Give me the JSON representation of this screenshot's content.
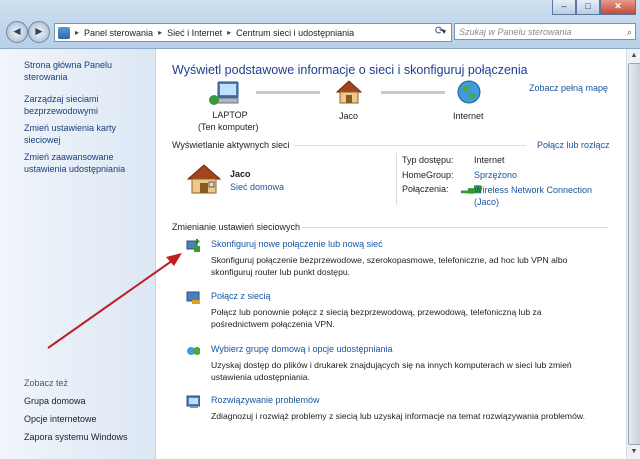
{
  "window": {
    "minimize": "–",
    "maximize": "□",
    "close": "✕"
  },
  "nav": {
    "back": "◄",
    "forward": "►",
    "breadcrumbs": [
      "Panel sterowania",
      "Sieć i Internet",
      "Centrum sieci i udostępniania"
    ],
    "search_placeholder": "Szukaj w Panelu sterowania",
    "search_icon": "magnifier-icon",
    "refresh_icon": "refresh-icon"
  },
  "sidebar": {
    "links": [
      {
        "line1": "Strona główna Panelu",
        "line2": "sterowania"
      },
      {
        "line1": "Zarządzaj sieciami",
        "line2": "bezprzewodowymi"
      },
      {
        "line1": "Zmień ustawienia karty",
        "line2": "sieciowej"
      },
      {
        "line1": "Zmień zaawansowane",
        "line2": "ustawienia udostępniania"
      }
    ],
    "see_also_heading": "Zobacz też",
    "see_also": [
      "Grupa domowa",
      "Opcje internetowe",
      "Zapora systemu Windows"
    ]
  },
  "main": {
    "title": "Wyświetl podstawowe informacje o sieci i skonfiguruj połączenia",
    "full_map_link": "Zobacz pełną mapę",
    "map": {
      "computer_name": "LAPTOP",
      "computer_sub": "(Ten komputer)",
      "network_name": "Jaco",
      "internet_label": "Internet"
    },
    "active_networks_heading": "Wyświetlanie aktywnych sieci",
    "connect_disconnect_link": "Połącz lub rozłącz",
    "active_network": {
      "name": "Jaco",
      "type_link": "Sieć domowa",
      "access_type_label": "Typ dostępu:",
      "access_type_value": "Internet",
      "homegroup_label": "HomeGroup:",
      "homegroup_value": "Sprzężono",
      "connections_label": "Połączenia:",
      "connection_line1": "Wireless Network Connection",
      "connection_line2": "(Jaco)"
    },
    "change_settings_heading": "Zmienianie ustawień sieciowych",
    "tasks": [
      {
        "title": "Skonfiguruj nowe połączenie lub nową sieć",
        "desc1": "Skonfiguruj połączenie bezprzewodowe, szerokopasmowe, telefoniczne, ad hoc lub VPN albo",
        "desc2": "skonfiguruj router lub punkt dostępu."
      },
      {
        "title": "Połącz z siecią",
        "desc1": "Połącz lub ponownie połącz z siecią bezprzewodową, przewodową, telefoniczną lub za",
        "desc2": "pośrednictwem połączenia VPN."
      },
      {
        "title": "Wybierz grupę domową i opcje udostępniania",
        "desc1": "Uzyskaj dostęp do plików i drukarek znajdujących się na innych komputerach w sieci lub zmień",
        "desc2": "ustawienia udostępniania."
      },
      {
        "title": "Rozwiązywanie problemów",
        "desc1": "Zdiagnozuj i rozwiąż problemy z siecią lub uzyskaj informacje na temat rozwiązywania problemów.",
        "desc2": ""
      }
    ]
  },
  "colors": {
    "link": "#1a56a0",
    "title": "#1e3f8f",
    "annotation_arrow": "#c0201f"
  }
}
